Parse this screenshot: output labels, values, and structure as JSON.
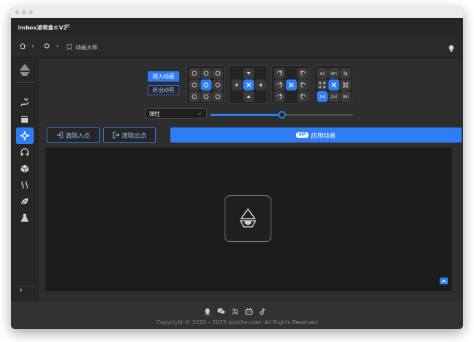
{
  "app": {
    "title": "Imbox凌萌盒©V2"
  },
  "navbar": {
    "breadcrumb": "动画大师"
  },
  "toolbar": {
    "enter_label": "进入动画",
    "exit_label": "退出动画"
  },
  "size_panel": {
    "labels": [
      "xs",
      "sm",
      "lg",
      "1xl",
      "2xl",
      "3xl"
    ]
  },
  "easing": {
    "value": "弹性"
  },
  "slider": {
    "value": 0.5
  },
  "actions": {
    "clear_in": "清除入点",
    "clear_out": "清除出点",
    "vip_badge": "VIP",
    "apply": "应用动画"
  },
  "footer": {
    "copyright": "Copyright © 2020 – 2023 sockite.com. All Rights Reserved",
    "taobao": "淘"
  },
  "colors": {
    "accent": "#2f7df4",
    "background": "#2e2e2e",
    "stage": "#1c1c1c"
  }
}
